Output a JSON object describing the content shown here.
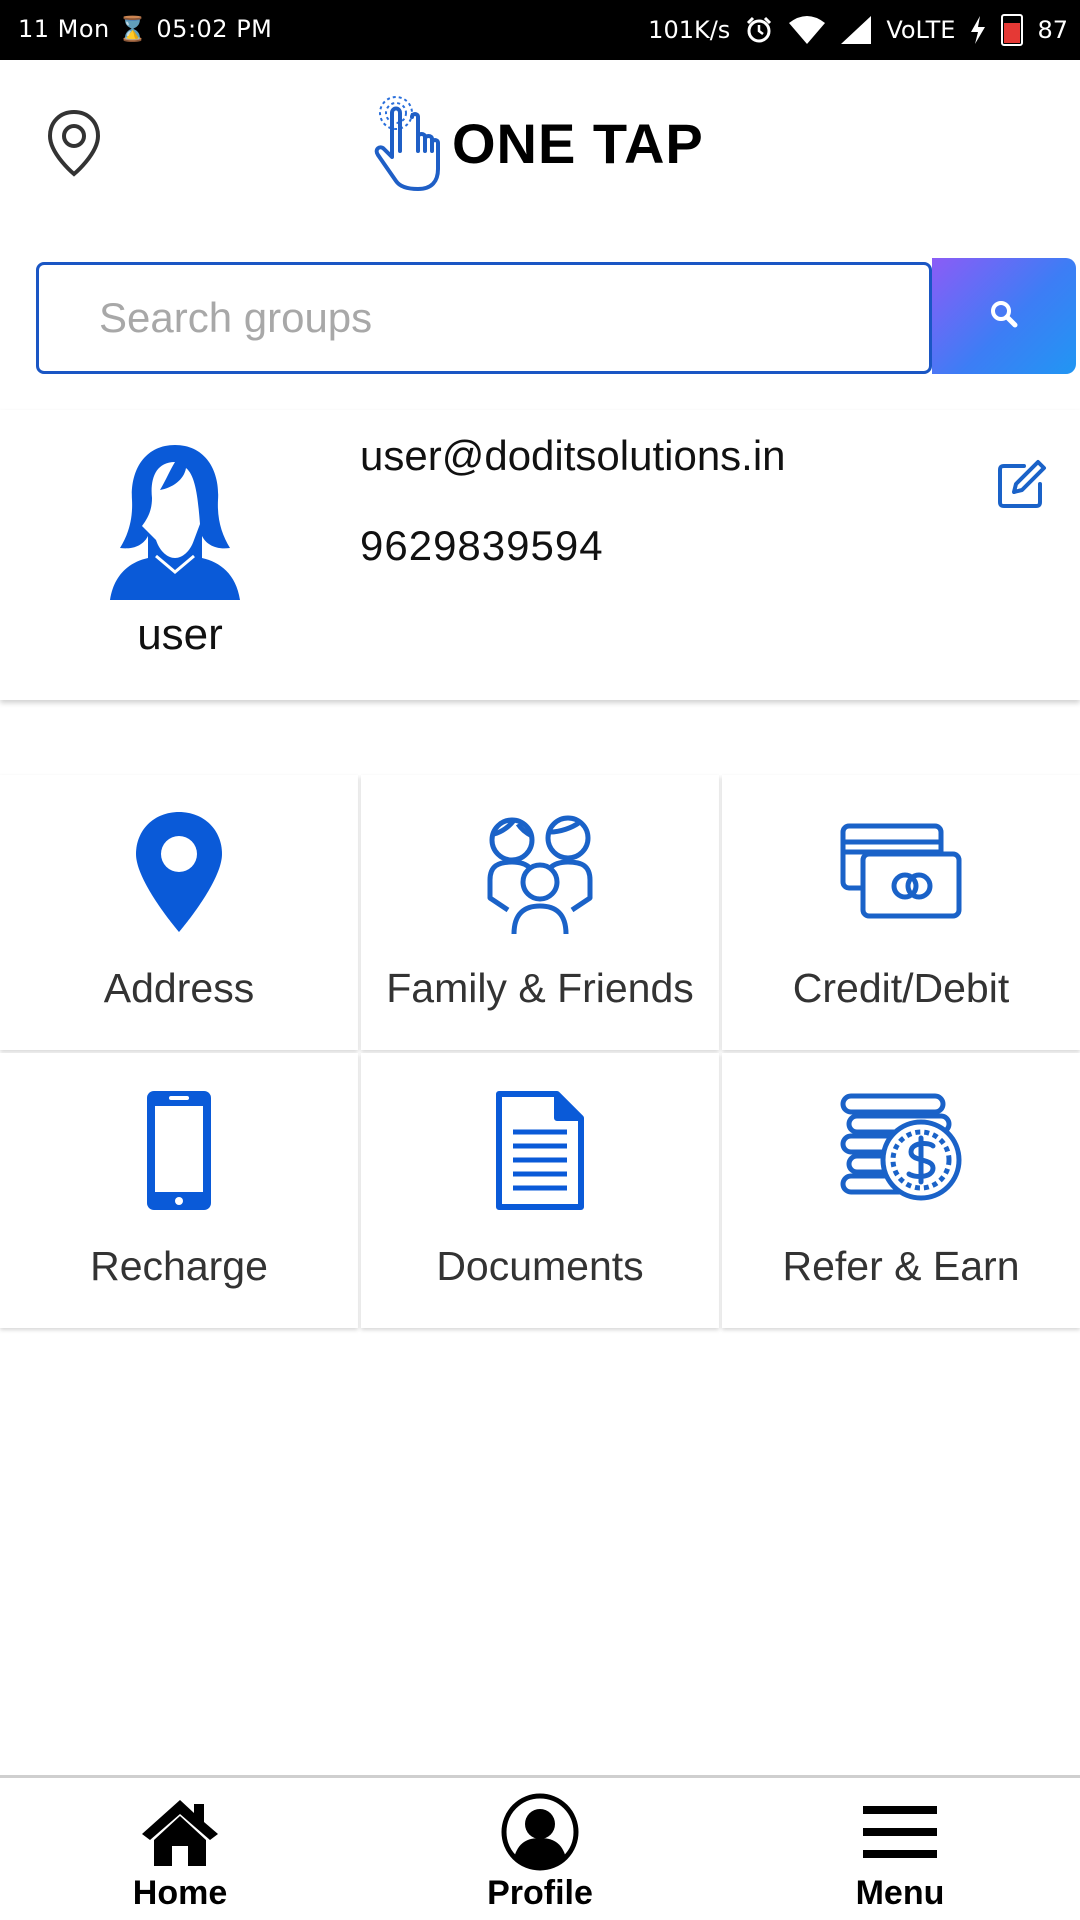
{
  "status_bar": {
    "left_text": "11 Mon ⌛ 05:02 PM",
    "speed": "101K/s",
    "network": "VoLTE",
    "battery": "87",
    "icons": [
      "alarm-icon",
      "wifi-icon",
      "signal-icon",
      "charging-icon",
      "battery-icon"
    ]
  },
  "header": {
    "location_icon": "map-pin-outline-icon",
    "logo_icon": "tap-hand-icon",
    "logo_text": "ONE TAP"
  },
  "search": {
    "placeholder": "Search groups",
    "value": "",
    "button_icon": "search-icon"
  },
  "profile": {
    "name": "user",
    "email": "user@doditsolutions.in",
    "phone": "9629839594",
    "avatar_icon": "female-avatar-icon",
    "edit_icon": "edit-icon"
  },
  "tiles": [
    {
      "label": "Address",
      "icon": "location-pin-icon"
    },
    {
      "label": "Family & Friends",
      "icon": "family-icon"
    },
    {
      "label": "Credit/Debit",
      "icon": "credit-card-icon"
    },
    {
      "label": "Recharge",
      "icon": "mobile-phone-icon"
    },
    {
      "label": "Documents",
      "icon": "document-icon"
    },
    {
      "label": "Refer & Earn",
      "icon": "coins-icon"
    }
  ],
  "bottom_nav": [
    {
      "label": "Home",
      "icon": "home-icon"
    },
    {
      "label": "Profile",
      "icon": "profile-icon"
    },
    {
      "label": "Menu",
      "icon": "menu-icon"
    }
  ],
  "colors": {
    "accent": "#0057d9",
    "search_border": "#1a56c4",
    "status_bar": "#000000",
    "battery": "#e53935"
  }
}
